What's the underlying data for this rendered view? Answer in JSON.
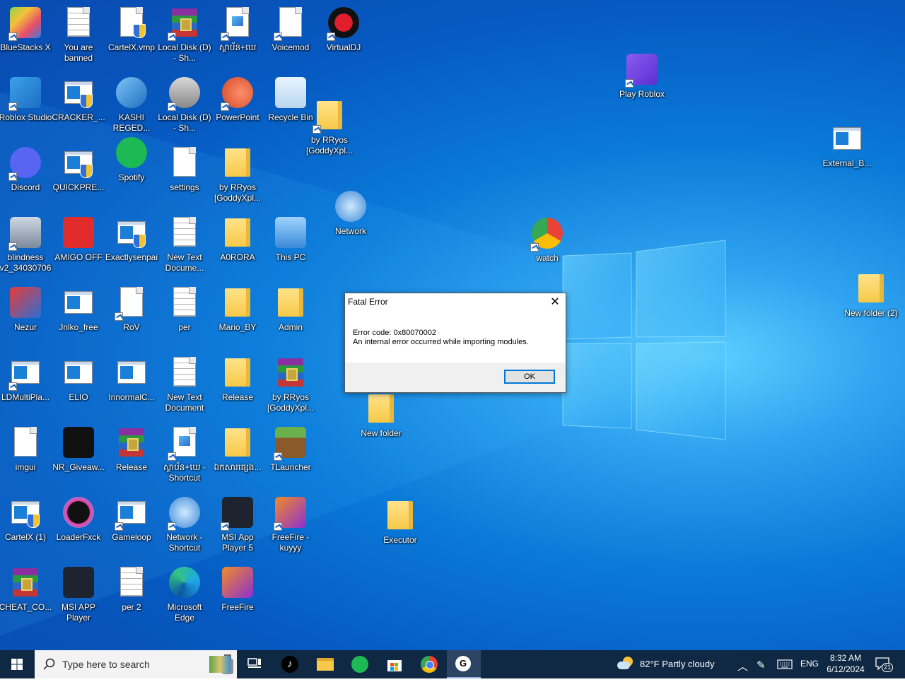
{
  "desktop": {
    "icons": [
      {
        "label": "BlueStacks X",
        "name": "bluestacks-x"
      },
      {
        "label": "You are banned",
        "name": "you-are-banned"
      },
      {
        "label": "CartelX.vmp",
        "name": "cartelx-vmp"
      },
      {
        "label": "Local Disk (D) - Sh...",
        "name": "local-disk-d-1"
      },
      {
        "label": "ស្ថាប័ន+ឃេ",
        "name": "khmer-file-1"
      },
      {
        "label": "Voicemod",
        "name": "voicemod"
      },
      {
        "label": "VirtualDJ",
        "name": "virtualdj"
      },
      {
        "label": "Roblox Studio",
        "name": "roblox-studio"
      },
      {
        "label": "CRACKER_...",
        "name": "cracker"
      },
      {
        "label": "KASHI REGED...",
        "name": "kashi-reged"
      },
      {
        "label": "Local Disk (D) - Sh...",
        "name": "local-disk-d-2"
      },
      {
        "label": "PowerPoint",
        "name": "powerpoint"
      },
      {
        "label": "Recycle Bin",
        "name": "recycle-bin"
      },
      {
        "label": "by RRyos [GoddyXpl...",
        "name": "by-rryos-1"
      },
      {
        "label": "Discord",
        "name": "discord"
      },
      {
        "label": "QUICKPRE...",
        "name": "quickpre"
      },
      {
        "label": "Spotify",
        "name": "spotify"
      },
      {
        "label": "settings",
        "name": "settings"
      },
      {
        "label": "by RRyos [GoddyXpl...",
        "name": "by-rryos-2"
      },
      {
        "label": "Network",
        "name": "network"
      },
      {
        "label": "watch",
        "name": "watch"
      },
      {
        "label": "blindness v2_34030706",
        "name": "blindness"
      },
      {
        "label": "AMIGO OFF",
        "name": "amigo-off"
      },
      {
        "label": "Exactlysenpai",
        "name": "exactlysenpai"
      },
      {
        "label": "New Text Docume...",
        "name": "new-text-doc-1"
      },
      {
        "label": "A0RORA",
        "name": "a0rora"
      },
      {
        "label": "This PC",
        "name": "this-pc"
      },
      {
        "label": "Nezur",
        "name": "nezur"
      },
      {
        "label": "Jnlko_free",
        "name": "jnlko-free"
      },
      {
        "label": "RoV",
        "name": "rov"
      },
      {
        "label": "per",
        "name": "per"
      },
      {
        "label": "Mario_BY",
        "name": "mario-by"
      },
      {
        "label": "Admin",
        "name": "admin"
      },
      {
        "label": "LDMultiPla...",
        "name": "ldmultiplayer"
      },
      {
        "label": "ELIO",
        "name": "elio"
      },
      {
        "label": "InnormalC...",
        "name": "innormalc"
      },
      {
        "label": "New Text Document",
        "name": "new-text-doc-2"
      },
      {
        "label": "Release",
        "name": "release-folder"
      },
      {
        "label": "by RRyos [GoddyXpl...",
        "name": "by-rryos-3"
      },
      {
        "label": "New folder",
        "name": "new-folder"
      },
      {
        "label": "imgui",
        "name": "imgui"
      },
      {
        "label": "NR_Giveaw...",
        "name": "nr-giveaway"
      },
      {
        "label": "Release",
        "name": "release-rar"
      },
      {
        "label": "ស្ថាប័ន+ឃេ - Shortcut",
        "name": "khmer-file-shortcut"
      },
      {
        "label": "ឯកសារផ្សេង...",
        "name": "khmer-folder"
      },
      {
        "label": "TLauncher",
        "name": "tlauncher"
      },
      {
        "label": "Executor",
        "name": "executor"
      },
      {
        "label": "CartelX (1)",
        "name": "cartelx-1"
      },
      {
        "label": "LoaderFxck",
        "name": "loaderfxck"
      },
      {
        "label": "Gameloop",
        "name": "gameloop"
      },
      {
        "label": "Network - Shortcut",
        "name": "network-shortcut"
      },
      {
        "label": "MSI App Player 5",
        "name": "msi-app-player-5"
      },
      {
        "label": "FreeFire - kuyyy",
        "name": "freefire-kuyyy"
      },
      {
        "label": "CHEAT_CO...",
        "name": "cheat-co"
      },
      {
        "label": "MSI APP Player",
        "name": "msi-app-player"
      },
      {
        "label": "per 2",
        "name": "per-2"
      },
      {
        "label": "Microsoft Edge",
        "name": "microsoft-edge"
      },
      {
        "label": "FreeFire",
        "name": "freefire"
      },
      {
        "label": "Play Roblox",
        "name": "play-roblox"
      },
      {
        "label": "External_B...",
        "name": "external-b"
      },
      {
        "label": "New folder (2)",
        "name": "new-folder-2"
      }
    ]
  },
  "dialog": {
    "title": "Fatal Error",
    "close": "✕",
    "error_code": "Error code: 0x80070002",
    "message": "An internal error occurred while importing modules.",
    "ok": "OK"
  },
  "taskbar": {
    "search_placeholder": "Type here to search",
    "weather": "82°F  Partly cloudy",
    "language": "ENG",
    "time": "8:32 AM",
    "date": "6/12/2024",
    "notifications": "21"
  }
}
